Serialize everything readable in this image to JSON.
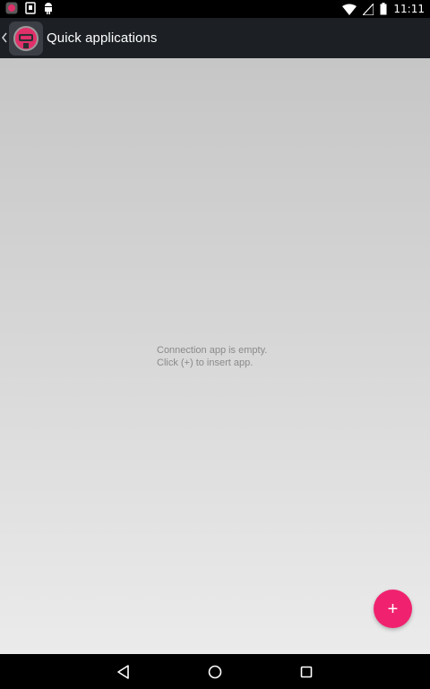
{
  "status_bar": {
    "time": "11:11",
    "left_icons": [
      "app-notification-icon",
      "sim-icon",
      "android-debug-icon"
    ],
    "right_icons": [
      "wifi-icon",
      "signal-icon",
      "battery-icon"
    ]
  },
  "app_bar": {
    "title": "Quick applications",
    "icons": [
      "back-chevron-icon",
      "app-logo-icon"
    ]
  },
  "main": {
    "empty_line1": "Connection app is empty.",
    "empty_line2": "Click (+) to insert app."
  },
  "fab": {
    "label": "+",
    "icon": "add-icon"
  },
  "nav_bar": {
    "icons": [
      "back-icon",
      "home-icon",
      "recents-icon"
    ]
  },
  "colors": {
    "accent": "#f0226f",
    "app_bar": "#1c2025",
    "background_top": "#c6c6c6",
    "background_bottom": "#ebebeb"
  }
}
